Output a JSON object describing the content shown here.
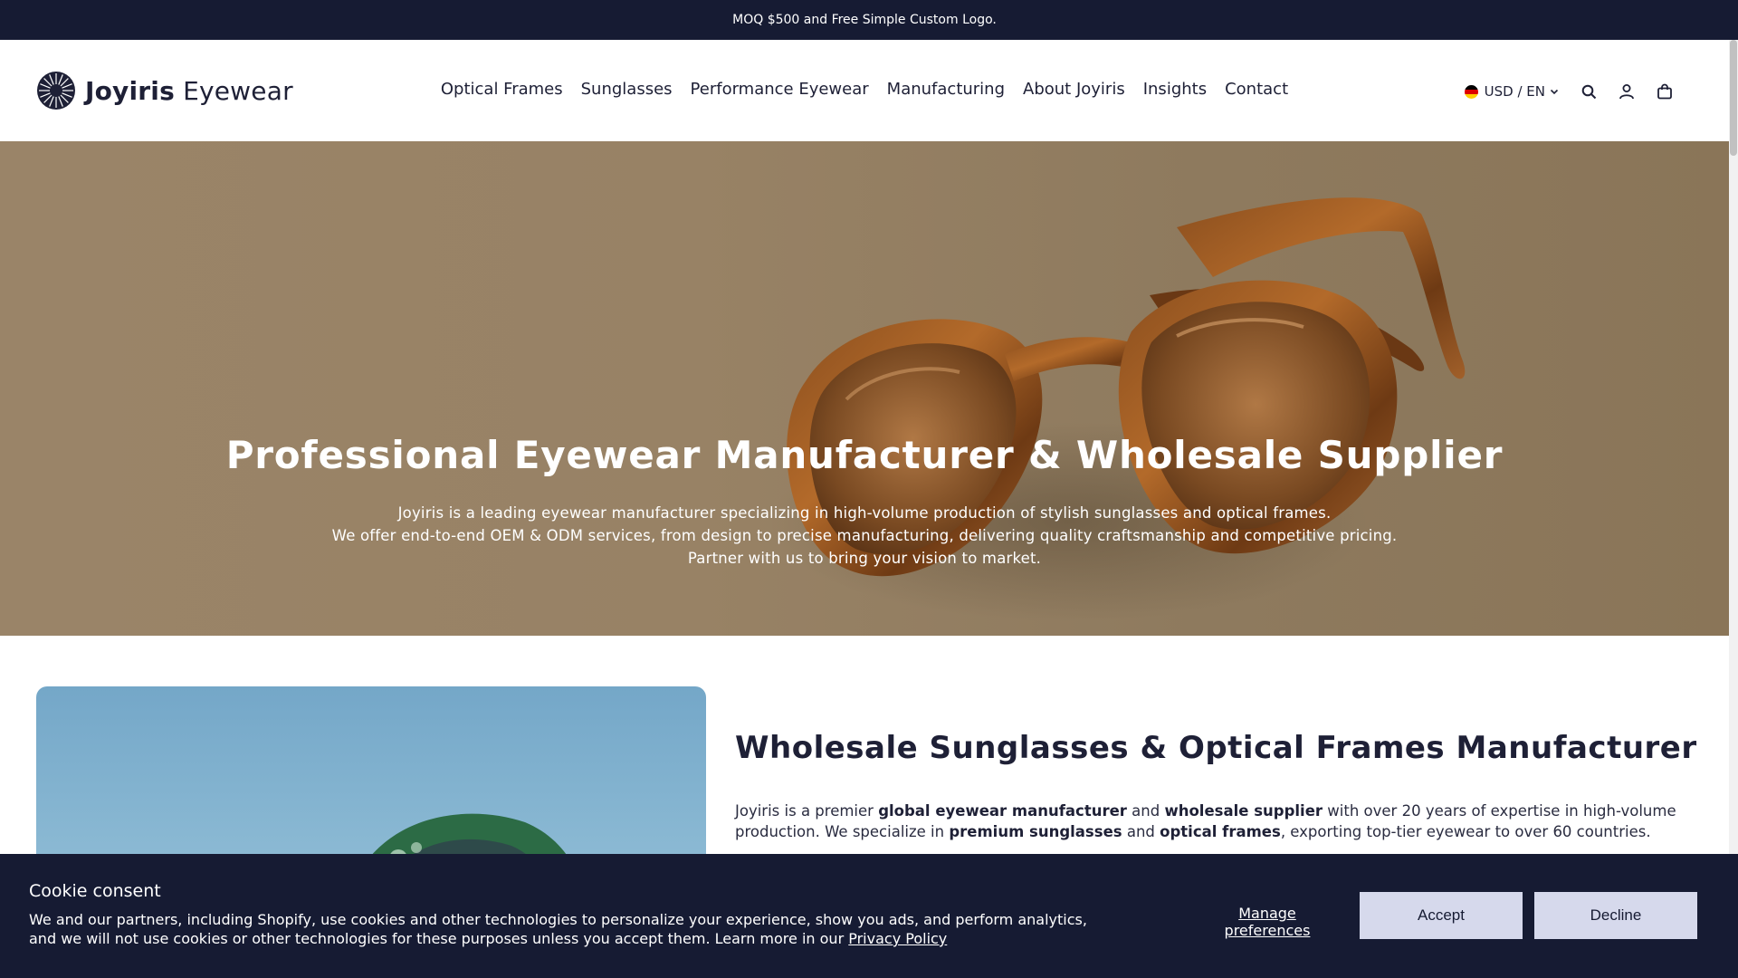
{
  "announcement": {
    "text": "MOQ $500 and Free Simple Custom Logo."
  },
  "header": {
    "logo": {
      "brand": "Joyiris",
      "suffix": "Eyewear"
    },
    "nav": [
      {
        "label": "Optical Frames"
      },
      {
        "label": "Sunglasses"
      },
      {
        "label": "Performance Eyewear"
      },
      {
        "label": "Manufacturing"
      },
      {
        "label": "About Joyiris"
      },
      {
        "label": "Insights"
      },
      {
        "label": "Contact"
      }
    ],
    "currency": {
      "label": "USD / EN",
      "flag_icon": "germany-flag-icon"
    },
    "icons": [
      "search-icon",
      "account-icon",
      "cart-icon"
    ]
  },
  "hero": {
    "title": "Professional Eyewear Manufacturer & Wholesale Supplier",
    "lines": [
      "Joyiris is a leading eyewear manufacturer specializing in high-volume production of stylish sunglasses and optical frames.",
      "We offer end-to-end OEM & ODM services, from design to precise manufacturing, delivering quality craftsmanship and competitive pricing.",
      "Partner with us to bring your vision to market."
    ]
  },
  "intro": {
    "title": "Wholesale Sunglasses & Optical Frames Manufacturer",
    "text": {
      "p1": "Joyiris is a premier ",
      "b1": "global eyewear manufacturer",
      "p2": " and ",
      "b2": "wholesale supplier",
      "p3": " with over 20 years of expertise in high-volume production. We specialize in ",
      "b3": "premium sunglasses",
      "p4": " and ",
      "b4": "optical frames",
      "p5": ", exporting top-tier eyewear to over 60 countries."
    }
  },
  "cookie": {
    "title": "Cookie consent",
    "text": "We and our partners, including Shopify, use cookies and other technologies to personalize your experience, show you ads, and perform analytics, and we will not use cookies or other technologies for these purposes unless you accept them. Learn more in our ",
    "link": "Privacy Policy",
    "manage": "Manage preferences",
    "accept": "Accept",
    "decline": "Decline"
  },
  "colors": {
    "dark_navy": "#161b33",
    "button_bg": "#d6d9ec",
    "hero_bg": "#998366"
  }
}
